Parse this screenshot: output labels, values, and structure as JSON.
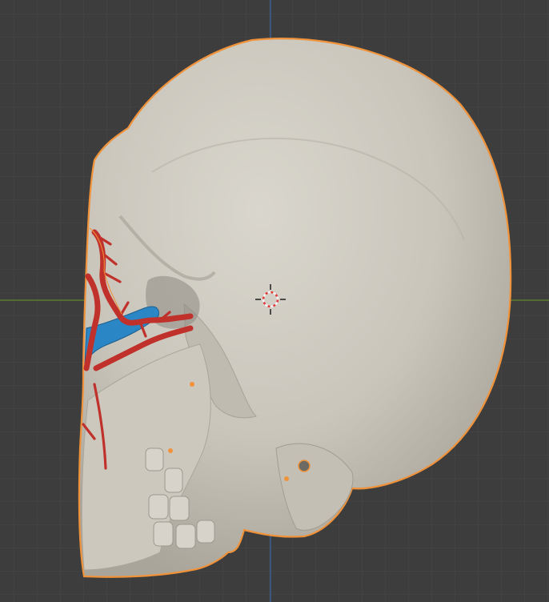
{
  "viewport": {
    "background_color": "#3d3d3d",
    "grid_color": "#474747",
    "x_axis_color": "#5a7d2e",
    "y_axis_color": "#3a5f8f"
  },
  "object": {
    "name": "skull",
    "selected": true,
    "selection_outline_color": "#f0923a",
    "bone_color": "#cfccc2",
    "artery_color": "#c0312b",
    "vein_color": "#2a86c4"
  },
  "cursor": {
    "icon": "3d-cursor-icon",
    "ring_colors": [
      "#e23a3a",
      "#f2f2f2"
    ]
  }
}
